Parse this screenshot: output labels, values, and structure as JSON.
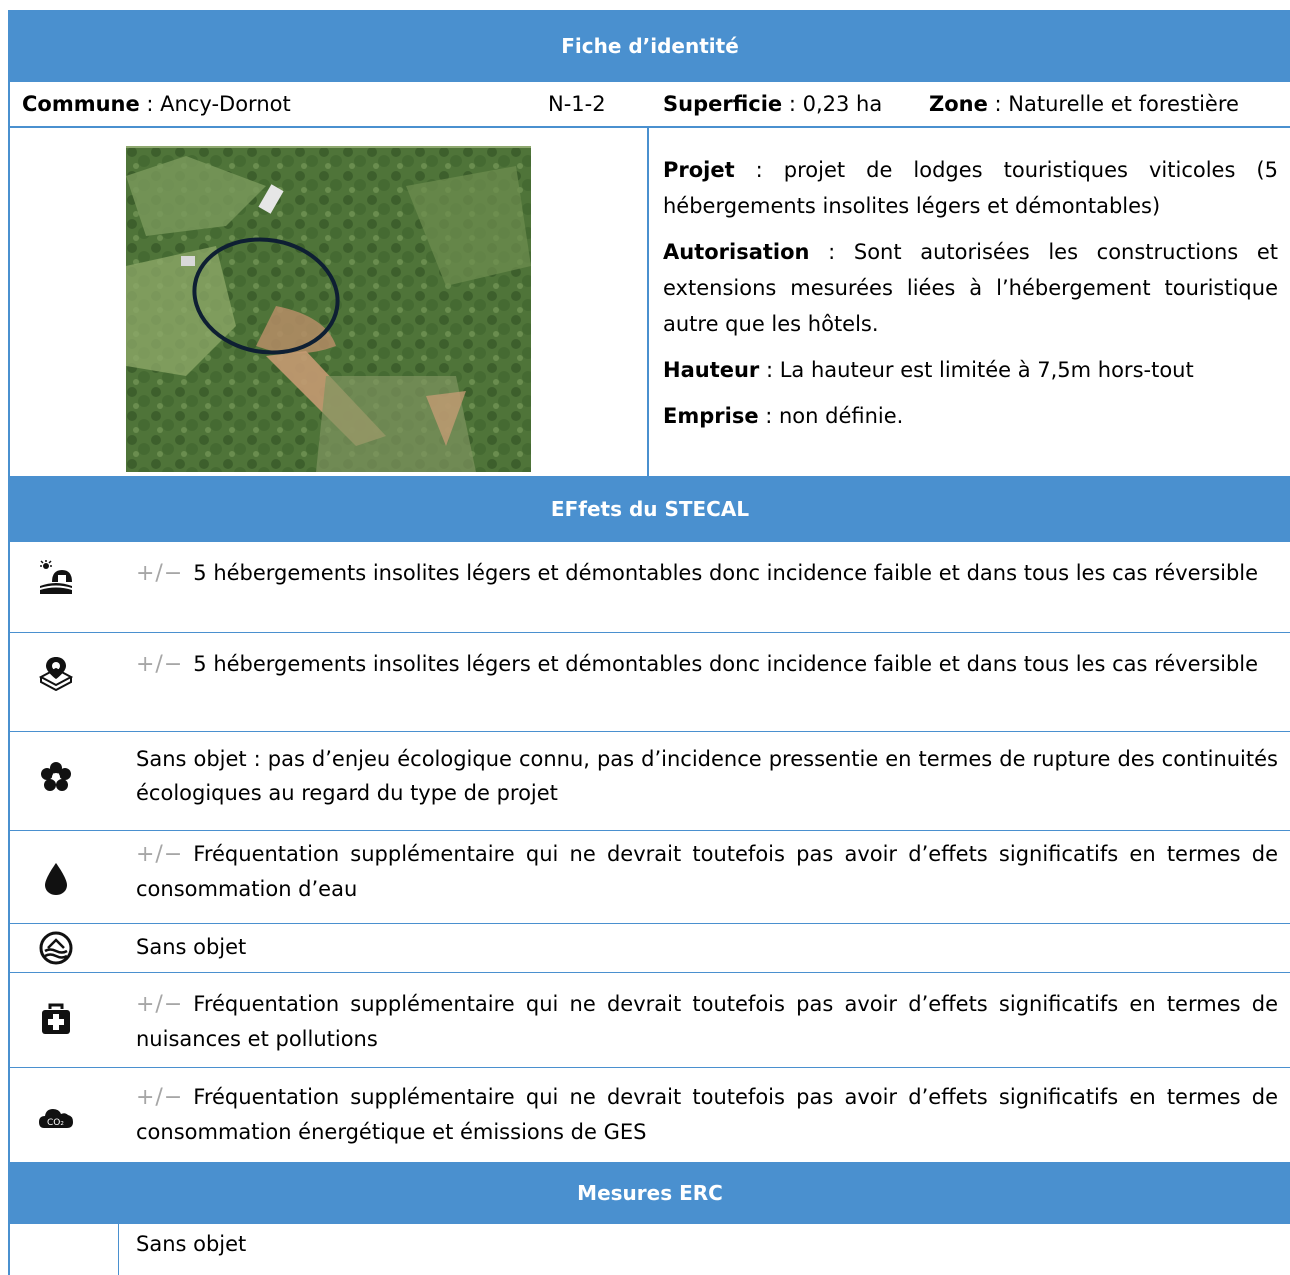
{
  "identity": {
    "header": "Fiche d’identité",
    "commune_label": "Commune",
    "commune_value": " : Ancy-Dornot",
    "code": "N-1-2",
    "superficie_label": "Superficie",
    "superficie_value": " : 0,23 ha",
    "zone_label": "Zone",
    "zone_value": " : Naturelle et forestière"
  },
  "project": {
    "projet_label": "Projet",
    "projet_value": " : projet de lodges touristiques viticoles (5 hébergements insolites légers et démontables)",
    "autorisation_label": "Autorisation",
    "autorisation_value": " : Sont autorisées les constructions et extensions mesurées liées à l’hébergement touristique autre que les hôtels.",
    "hauteur_label": "Hauteur",
    "hauteur_value": " : La hauteur est limitée à 7,5m hors-tout",
    "emprise_label": "Emprise",
    "emprise_value": " : non définie."
  },
  "effects": {
    "header": "EFfets du STECAL",
    "plus_minus": "+/−",
    "items": [
      {
        "icon": "landscape-icon",
        "text": "5 hébergements insolites légers et démontables donc incidence faible et dans tous les cas réversible"
      },
      {
        "icon": "location-pin-icon",
        "text": "5 hébergements insolites légers et démontables donc incidence faible et dans tous les cas réversible"
      },
      {
        "icon": "flower-icon",
        "text": "Sans objet : pas d’enjeu écologique connu, pas d’incidence pressentie en termes de rupture des continuités écologiques au regard du type de projet"
      },
      {
        "icon": "water-drop-icon",
        "text": "Fréquentation supplémentaire qui ne devrait toutefois pas avoir d’effets significatifs en termes de consommation d’eau"
      },
      {
        "icon": "flood-risk-icon",
        "text": "Sans objet"
      },
      {
        "icon": "first-aid-kit-icon",
        "text": "Fréquentation supplémentaire qui ne devrait toutefois pas avoir d’effets significatifs en termes de nuisances et pollutions"
      },
      {
        "icon": "co2-cloud-icon",
        "text": "Fréquentation supplémentaire qui ne devrait toutefois pas avoir d’effets significatifs en termes de consommation énergétique et émissions de GES"
      }
    ]
  },
  "measures": {
    "header": "Mesures ERC",
    "text": "Sans objet"
  },
  "colors": {
    "header_bg": "#4a90cf",
    "plus_minus": "#a6a6a6"
  }
}
